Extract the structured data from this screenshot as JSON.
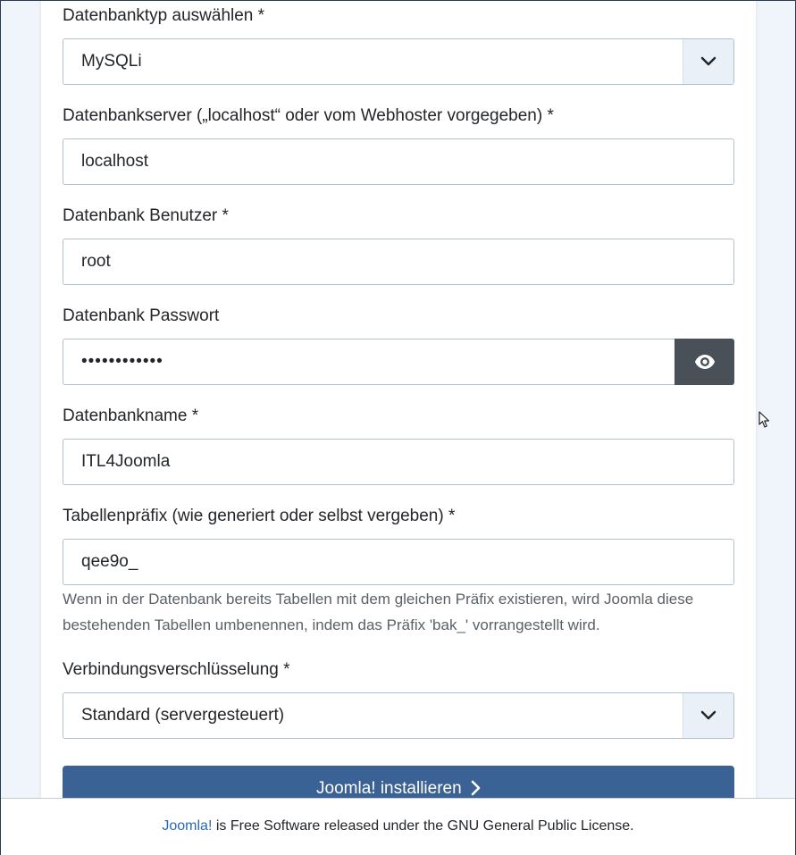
{
  "form": {
    "db_type": {
      "label": "Datenbanktyp auswählen *",
      "value": "MySQLi"
    },
    "db_host": {
      "label": "Datenbankserver („localhost“ oder vom Webhoster vorgegeben) *",
      "value": "localhost"
    },
    "db_user": {
      "label": "Datenbank Benutzer *",
      "value": "root"
    },
    "db_pass": {
      "label": "Datenbank Passwort",
      "value": "••••••••••••",
      "toggle_icon": "eye-icon"
    },
    "db_name": {
      "label": "Datenbankname *",
      "value": "ITL4Joomla"
    },
    "db_prefix": {
      "label": "Tabellenpräfix (wie generiert oder selbst vergeben) *",
      "value": "qee9o_",
      "help": "Wenn in der Datenbank bereits Tabellen mit dem gleichen Präfix existieren, wird Joomla diese bestehenden Tabellen umbenennen, indem das Präfix 'bak_' vorrangestellt wird."
    },
    "db_encryption": {
      "label": "Verbindungsverschlüsselung *",
      "value": "Standard (servergesteuert)"
    },
    "install_button": "Joomla! installieren"
  },
  "footer": {
    "link_text": "Joomla!",
    "text": " is Free Software released under the GNU General Public License."
  },
  "colors": {
    "primary_button": "#3b6294",
    "password_toggle": "#495057",
    "link": "#2a69b8",
    "select_arrow_bg": "#eaf0f7"
  }
}
